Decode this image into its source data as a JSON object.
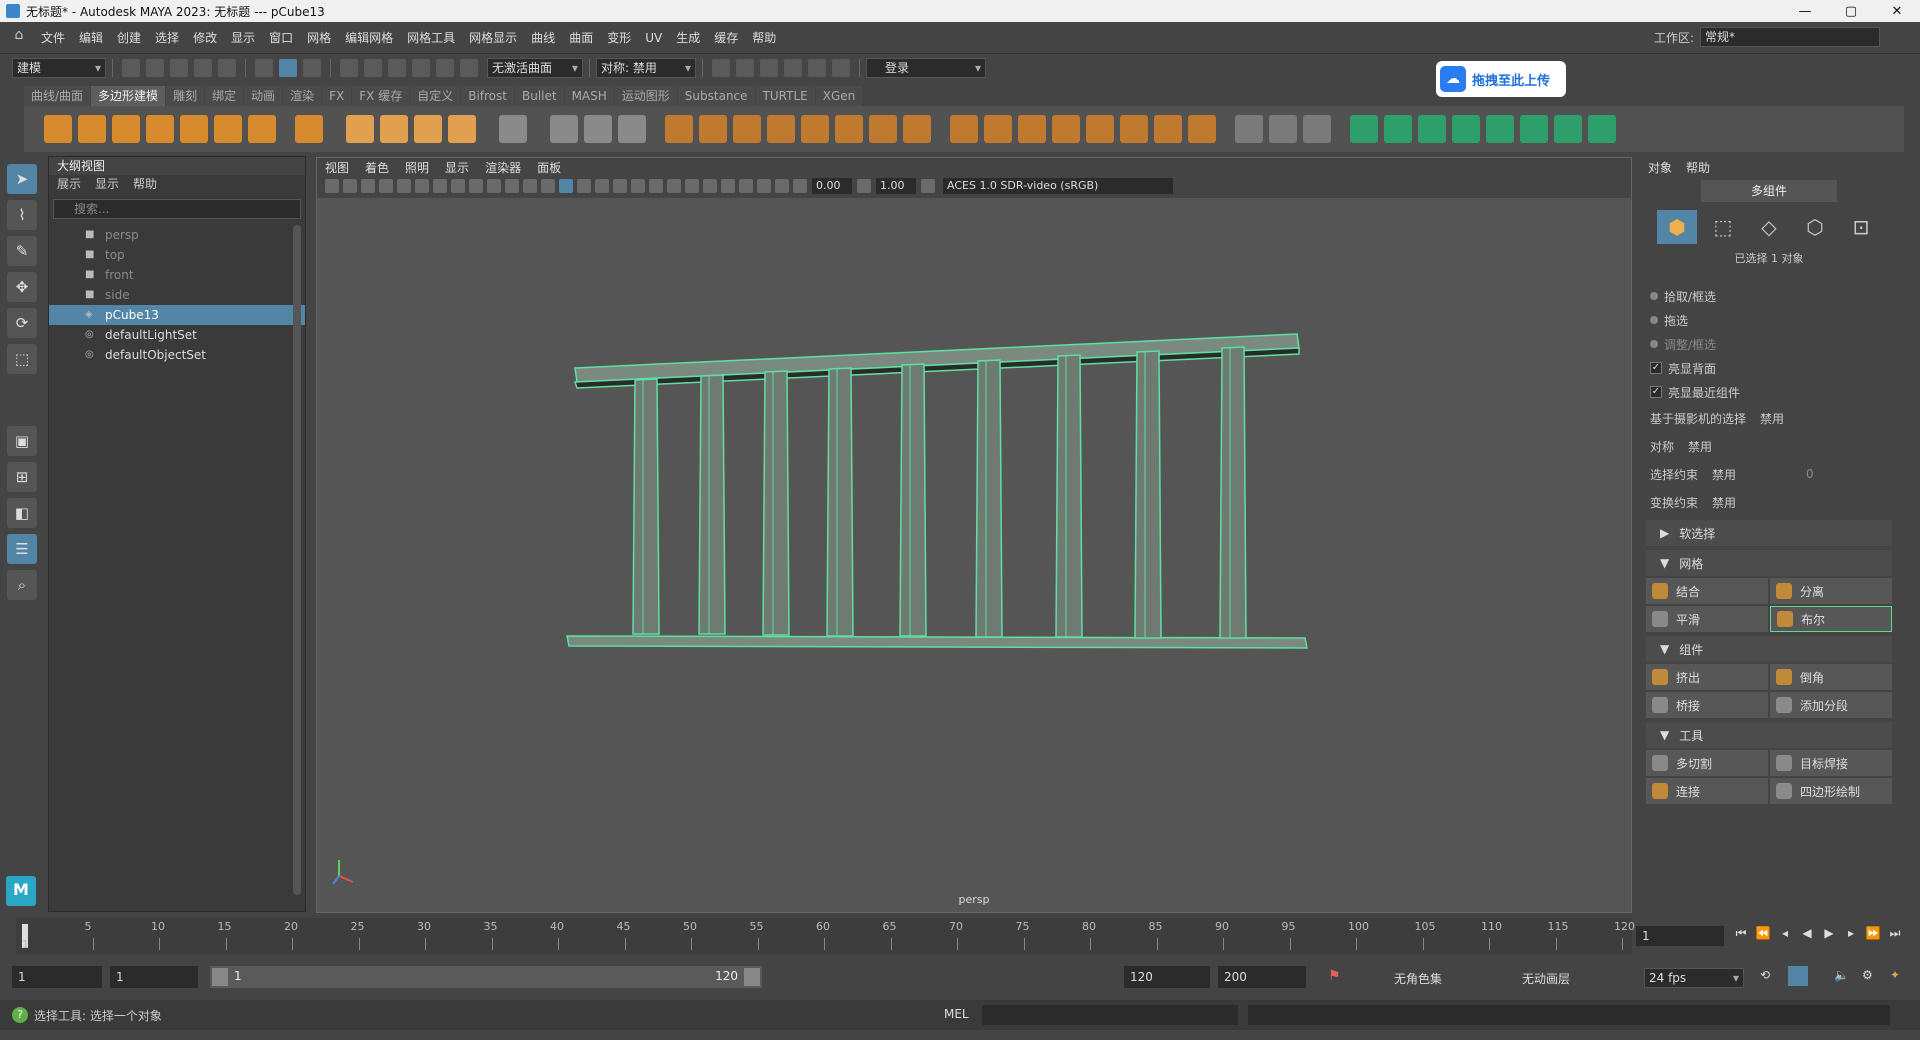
{
  "window": {
    "title": "无标题* - Autodesk MAYA 2023: 无标题   ---   pCube13",
    "controls": [
      "—",
      "▢",
      "✕"
    ]
  },
  "menubar": {
    "items": [
      "文件",
      "编辑",
      "创建",
      "选择",
      "修改",
      "显示",
      "窗口",
      "网格",
      "编辑网格",
      "网格工具",
      "网格显示",
      "曲线",
      "曲面",
      "变形",
      "UV",
      "生成",
      "缓存",
      "帮助"
    ],
    "workspace_label": "工作区:",
    "workspace_value": "常规*"
  },
  "toolbar": {
    "mode": "建模",
    "live_surface": "无激活曲面",
    "symmetry": "对称: 禁用",
    "login": "登录"
  },
  "upload_widget": {
    "label": "拖拽至此上传"
  },
  "shelf": {
    "tabs": [
      "曲线/曲面",
      "多边形建模",
      "雕刻",
      "绑定",
      "动画",
      "渲染",
      "FX",
      "FX 缓存",
      "自定义",
      "Bifrost",
      "Bullet",
      "MASH",
      "运动图形",
      "Substance",
      "TURTLE",
      "XGen"
    ],
    "active_tab": "多边形建模"
  },
  "outliner": {
    "title": "大纲视图",
    "menu": [
      "展示",
      "显示",
      "帮助"
    ],
    "search_placeholder": "搜索...",
    "items": [
      {
        "label": "persp",
        "icon": "camera-icon",
        "dim": true
      },
      {
        "label": "top",
        "icon": "camera-icon",
        "dim": true
      },
      {
        "label": "front",
        "icon": "camera-icon",
        "dim": true
      },
      {
        "label": "side",
        "icon": "camera-icon",
        "dim": true
      },
      {
        "label": "pCube13",
        "icon": "mesh-icon",
        "selected": true
      },
      {
        "label": "defaultLightSet",
        "icon": "set-icon"
      },
      {
        "label": "defaultObjectSet",
        "icon": "set-icon"
      }
    ]
  },
  "viewport": {
    "menu": [
      "视图",
      "着色",
      "照明",
      "显示",
      "渲染器",
      "面板"
    ],
    "exposure": "0.00",
    "gamma": "1.00",
    "color_space": "ACES 1.0 SDR-video (sRGB)",
    "camera_label": "persp",
    "mesh_color": "#5fe0a0",
    "bg_color": "#555555"
  },
  "modeling_toolkit": {
    "menu": [
      "对象",
      "帮助"
    ],
    "multi_component": "多组件",
    "selected_info": "已选择 1 对象",
    "pick_options": [
      {
        "label": "拾取/框选",
        "type": "radio"
      },
      {
        "label": "拖选",
        "type": "radio"
      },
      {
        "label": "调整/框选",
        "type": "radio",
        "dim": true
      },
      {
        "label": "亮显背面",
        "type": "check"
      },
      {
        "label": "亮显最近组件",
        "type": "check"
      }
    ],
    "camera_based": {
      "label": "基于摄影机的选择",
      "value": "禁用"
    },
    "symmetry": {
      "label": "对称",
      "value": "禁用"
    },
    "select_constraint": {
      "label": "选择约束",
      "value": "禁用",
      "extra": "0"
    },
    "transform_constraint": {
      "label": "变换约束",
      "value": "禁用"
    },
    "soft_select": "软选择",
    "sections": {
      "mesh": {
        "title": "网格",
        "buttons": [
          "结合",
          "分离",
          "平滑",
          "布尔"
        ]
      },
      "components": {
        "title": "组件",
        "buttons": [
          "挤出",
          "倒角",
          "桥接",
          "添加分段"
        ]
      },
      "tools": {
        "title": "工具",
        "buttons": [
          "多切割",
          "目标焊接",
          "连接",
          "四边形绘制"
        ]
      }
    }
  },
  "timeline": {
    "ticks": [
      "5",
      "10",
      "15",
      "20",
      "25",
      "30",
      "35",
      "40",
      "45",
      "50",
      "55",
      "60",
      "65",
      "70",
      "75",
      "80",
      "85",
      "90",
      "95",
      "100",
      "105",
      "110",
      "115",
      "120"
    ],
    "current_frame": "1",
    "start_frame_indicator": "1"
  },
  "range": {
    "start": "1",
    "playback_start": "1",
    "slider_start": "1",
    "slider_end": "120",
    "playback_end": "120",
    "end": "200",
    "character_set": "无角色集",
    "anim_layer": "无动画层",
    "fps": "24 fps"
  },
  "status": {
    "help_text": "选择工具: 选择一个对象",
    "mel_label": "MEL"
  }
}
